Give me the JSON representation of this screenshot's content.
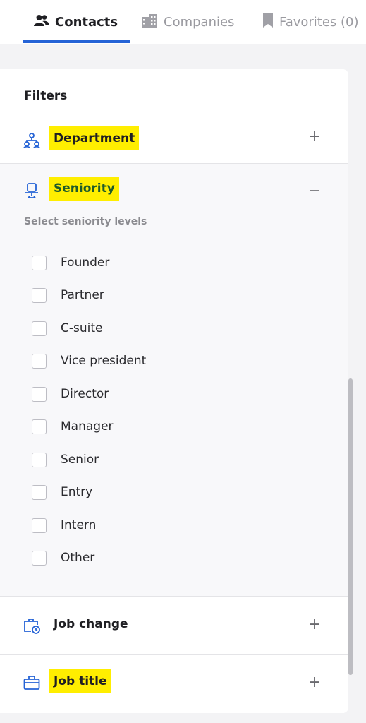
{
  "tabs": {
    "contacts": {
      "label": "Contacts",
      "icon": "people-icon"
    },
    "companies": {
      "label": "Companies",
      "icon": "building-icon"
    },
    "favorites": {
      "label": "Favorites (0)",
      "icon": "bookmark-icon"
    },
    "active": "Contacts"
  },
  "filters": {
    "title": "Filters",
    "sections": {
      "department": {
        "label": "Department",
        "toggle": "+",
        "highlighted": true
      },
      "seniority": {
        "label": "Seniority",
        "toggle": "−",
        "highlighted": true,
        "hint": "Select seniority levels",
        "options": [
          "Founder",
          "Partner",
          "C-suite",
          "Vice president",
          "Director",
          "Manager",
          "Senior",
          "Entry",
          "Intern",
          "Other"
        ]
      },
      "job_change": {
        "label": "Job change",
        "toggle": "+",
        "highlighted": false
      },
      "job_title": {
        "label": "Job title",
        "toggle": "+",
        "highlighted": true
      }
    }
  },
  "colors": {
    "accent": "#2563d6",
    "highlight": "#ffee00",
    "seniority_text": "#1f5b2a"
  }
}
